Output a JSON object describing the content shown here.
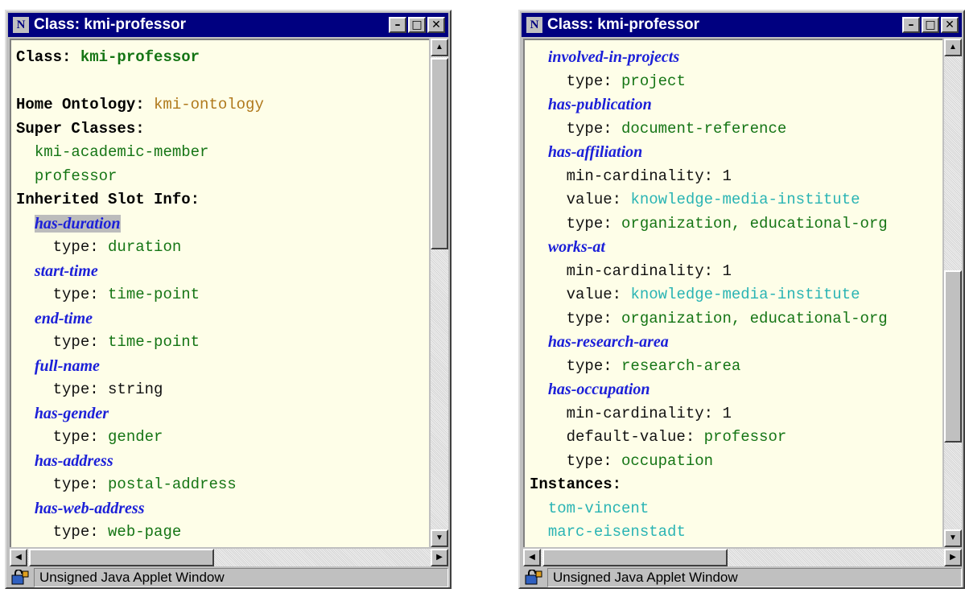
{
  "windows": [
    {
      "title": "Class: kmi-professor",
      "status": "Unsigned Java Applet Window",
      "lines": [
        [
          {
            "t": "Class: ",
            "c": "k"
          },
          {
            "t": "kmi-professor",
            "c": "gb"
          }
        ],
        [],
        [
          {
            "t": "Home Ontology: ",
            "c": "k"
          },
          {
            "t": "kmi-ontology",
            "c": "o"
          }
        ],
        [
          {
            "t": "Super Classes:",
            "c": "k"
          }
        ],
        [
          {
            "t": "  "
          },
          {
            "t": "kmi-academic-member",
            "c": "g"
          }
        ],
        [
          {
            "t": "  "
          },
          {
            "t": "professor",
            "c": "g"
          }
        ],
        [
          {
            "t": "Inherited Slot Info:",
            "c": "k"
          }
        ],
        [
          {
            "t": "  "
          },
          {
            "t": "has-duration",
            "c": "s hl"
          }
        ],
        [
          {
            "t": "    "
          },
          {
            "t": "type: ",
            "c": "t"
          },
          {
            "t": "duration",
            "c": "g"
          }
        ],
        [
          {
            "t": "  "
          },
          {
            "t": "start-time",
            "c": "s"
          }
        ],
        [
          {
            "t": "    "
          },
          {
            "t": "type: ",
            "c": "t"
          },
          {
            "t": "time-point",
            "c": "g"
          }
        ],
        [
          {
            "t": "  "
          },
          {
            "t": "end-time",
            "c": "s"
          }
        ],
        [
          {
            "t": "    "
          },
          {
            "t": "type: ",
            "c": "t"
          },
          {
            "t": "time-point",
            "c": "g"
          }
        ],
        [
          {
            "t": "  "
          },
          {
            "t": "full-name",
            "c": "s"
          }
        ],
        [
          {
            "t": "    "
          },
          {
            "t": "type: ",
            "c": "t"
          },
          {
            "t": "string",
            "c": "t"
          }
        ],
        [
          {
            "t": "  "
          },
          {
            "t": "has-gender",
            "c": "s"
          }
        ],
        [
          {
            "t": "    "
          },
          {
            "t": "type: ",
            "c": "t"
          },
          {
            "t": "gender",
            "c": "g"
          }
        ],
        [
          {
            "t": "  "
          },
          {
            "t": "has-address",
            "c": "s"
          }
        ],
        [
          {
            "t": "    "
          },
          {
            "t": "type: ",
            "c": "t"
          },
          {
            "t": "postal-address",
            "c": "g"
          }
        ],
        [
          {
            "t": "  "
          },
          {
            "t": "has-web-address",
            "c": "s"
          }
        ],
        [
          {
            "t": "    "
          },
          {
            "t": "type: ",
            "c": "t"
          },
          {
            "t": "web-page",
            "c": "g"
          }
        ]
      ]
    },
    {
      "title": "Class: kmi-professor",
      "status": "Unsigned Java Applet Window",
      "lines": [
        [
          {
            "t": "  "
          },
          {
            "t": "involved-in-projects",
            "c": "s"
          }
        ],
        [
          {
            "t": "    "
          },
          {
            "t": "type: ",
            "c": "t"
          },
          {
            "t": "project",
            "c": "g"
          }
        ],
        [
          {
            "t": "  "
          },
          {
            "t": "has-publication",
            "c": "s"
          }
        ],
        [
          {
            "t": "    "
          },
          {
            "t": "type: ",
            "c": "t"
          },
          {
            "t": "document-reference",
            "c": "g"
          }
        ],
        [
          {
            "t": "  "
          },
          {
            "t": "has-affiliation",
            "c": "s"
          }
        ],
        [
          {
            "t": "    "
          },
          {
            "t": "min-cardinality: 1",
            "c": "t"
          }
        ],
        [
          {
            "t": "    "
          },
          {
            "t": "value: ",
            "c": "t"
          },
          {
            "t": "knowledge-media-institute",
            "c": "c"
          }
        ],
        [
          {
            "t": "    "
          },
          {
            "t": "type: ",
            "c": "t"
          },
          {
            "t": "organization, educational-org",
            "c": "g"
          }
        ],
        [
          {
            "t": "  "
          },
          {
            "t": "works-at",
            "c": "s"
          }
        ],
        [
          {
            "t": "    "
          },
          {
            "t": "min-cardinality: 1",
            "c": "t"
          }
        ],
        [
          {
            "t": "    "
          },
          {
            "t": "value: ",
            "c": "t"
          },
          {
            "t": "knowledge-media-institute",
            "c": "c"
          }
        ],
        [
          {
            "t": "    "
          },
          {
            "t": "type: ",
            "c": "t"
          },
          {
            "t": "organization, educational-org",
            "c": "g"
          }
        ],
        [
          {
            "t": "  "
          },
          {
            "t": "has-research-area",
            "c": "s"
          }
        ],
        [
          {
            "t": "    "
          },
          {
            "t": "type: ",
            "c": "t"
          },
          {
            "t": "research-area",
            "c": "g"
          }
        ],
        [
          {
            "t": "  "
          },
          {
            "t": "has-occupation",
            "c": "s"
          }
        ],
        [
          {
            "t": "    "
          },
          {
            "t": "min-cardinality: 1",
            "c": "t"
          }
        ],
        [
          {
            "t": "    "
          },
          {
            "t": "default-value: ",
            "c": "t"
          },
          {
            "t": "professor",
            "c": "g"
          }
        ],
        [
          {
            "t": "    "
          },
          {
            "t": "type: ",
            "c": "t"
          },
          {
            "t": "occupation",
            "c": "g"
          }
        ],
        [
          {
            "t": "Instances:",
            "c": "k"
          }
        ],
        [
          {
            "t": "  "
          },
          {
            "t": "tom-vincent",
            "c": "c"
          }
        ],
        [
          {
            "t": "  "
          },
          {
            "t": "marc-eisenstadt",
            "c": "c"
          }
        ]
      ]
    }
  ]
}
